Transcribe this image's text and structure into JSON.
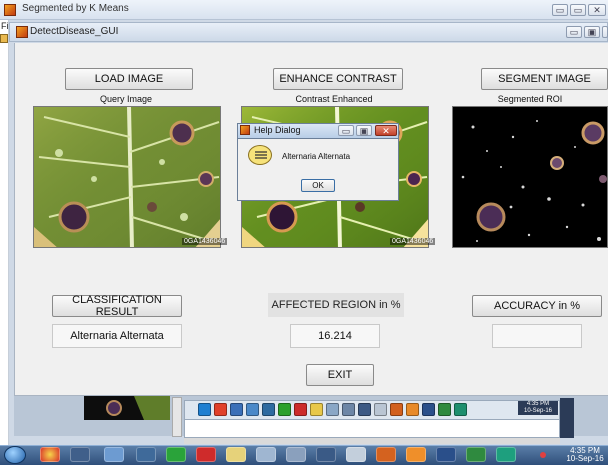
{
  "outer_window": {
    "title": "Segmented by K Means",
    "side_label": "Fi",
    "controls": [
      "▭",
      "▭",
      "✕"
    ]
  },
  "gui_window": {
    "title": "DetectDisease_GUI",
    "controls": [
      "▭",
      "▣",
      "✕"
    ]
  },
  "buttons": {
    "load": "LOAD IMAGE",
    "enhance": "ENHANCE CONTRAST",
    "segment": "SEGMENT IMAGE",
    "classify": "CLASSIFICATION RESULT",
    "accuracy": "ACCURACY in %",
    "exit": "EXIT"
  },
  "captions": {
    "query": "Query Image",
    "enhanced": "Contrast Enhanced",
    "segmented": "Segmented ROI"
  },
  "image_watermark": "0GA1436046",
  "labels": {
    "affected": "AFFECTED REGION in %"
  },
  "results": {
    "classification": "Alternaria Alternata",
    "affected_value": "16.214",
    "accuracy_value": ""
  },
  "help_dialog": {
    "title": "Help Dialog",
    "message": "Alternaria Alternata",
    "ok": "OK"
  },
  "inner_taskbar_clock": {
    "time": "4:35 PM",
    "date": "10-Sep-16"
  },
  "taskbar_clock": {
    "time": "4:35 PM",
    "date": "10-Sep-16"
  },
  "colors": {
    "leaf_green": "#7f9a3c",
    "lesion": "#5b3a5e",
    "panel": "#f0f0f0"
  }
}
